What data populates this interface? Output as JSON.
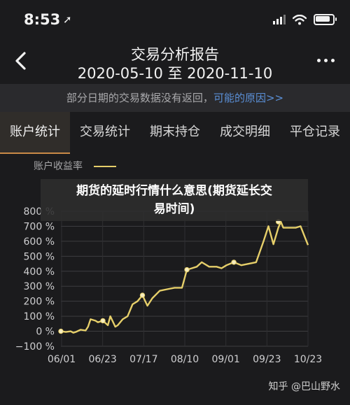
{
  "status_bar": {
    "time": "8:53",
    "location_arrow": "➚"
  },
  "nav": {
    "title": "交易分析报告",
    "subtitle": "2020-05-10 至 2020-11-10",
    "back_icon": "chevron-left-icon",
    "more_icon": "more-dots-icon"
  },
  "notice": {
    "text": "部分日期的交易数据没有返回，",
    "link": "可能的原因>>"
  },
  "tabs": [
    "账户统计",
    "交易统计",
    "期末持仓",
    "成交明细",
    "平仓记录"
  ],
  "active_tab": 0,
  "overlay": {
    "line1": "期货的延时行情什么意思(期货延长交",
    "line2": "易时间)"
  },
  "watermark": "知乎 @巴山野水",
  "colors": {
    "accent": "#c98a47",
    "line": "#e6cf6a",
    "link": "#5a8fd6"
  },
  "chart_data": {
    "type": "line",
    "legend": "账户收益率",
    "ylim": [
      -100,
      800
    ],
    "yticks": [
      "800 %",
      "700 %",
      "600 %",
      "500 %",
      "400 %",
      "300 %",
      "200 %",
      "100 %",
      "0 %",
      "−100 %"
    ],
    "xticks": [
      "06/01",
      "06/23",
      "07/17",
      "08/10",
      "09/01",
      "09/23",
      "10/23"
    ],
    "grid": true,
    "series": [
      {
        "name": "账户收益率",
        "x": [
          0,
          2,
          4,
          5,
          6,
          8,
          10,
          11,
          12,
          14,
          15,
          17,
          19,
          20,
          22,
          23,
          25,
          27,
          29,
          31,
          33,
          35,
          37,
          40,
          43,
          46,
          49,
          51,
          53,
          55,
          57,
          60,
          63,
          65,
          67,
          70,
          73,
          76,
          79,
          82,
          84,
          86,
          88,
          89,
          90,
          92,
          93,
          95,
          97,
          100
        ],
        "y": [
          0,
          -5,
          0,
          -10,
          -5,
          10,
          5,
          30,
          80,
          70,
          60,
          70,
          40,
          100,
          30,
          40,
          80,
          100,
          180,
          200,
          240,
          170,
          220,
          270,
          280,
          290,
          290,
          410,
          420,
          430,
          460,
          430,
          430,
          420,
          440,
          460,
          440,
          450,
          460,
          600,
          700,
          580,
          690,
          730,
          690,
          690,
          690,
          690,
          700,
          575
        ]
      }
    ],
    "markers": [
      {
        "x": 0,
        "y": 0
      },
      {
        "x": 17,
        "y": 70
      },
      {
        "x": 33,
        "y": 240
      },
      {
        "x": 51,
        "y": 410
      },
      {
        "x": 70,
        "y": 460
      },
      {
        "x": 88,
        "y": 730
      }
    ]
  }
}
